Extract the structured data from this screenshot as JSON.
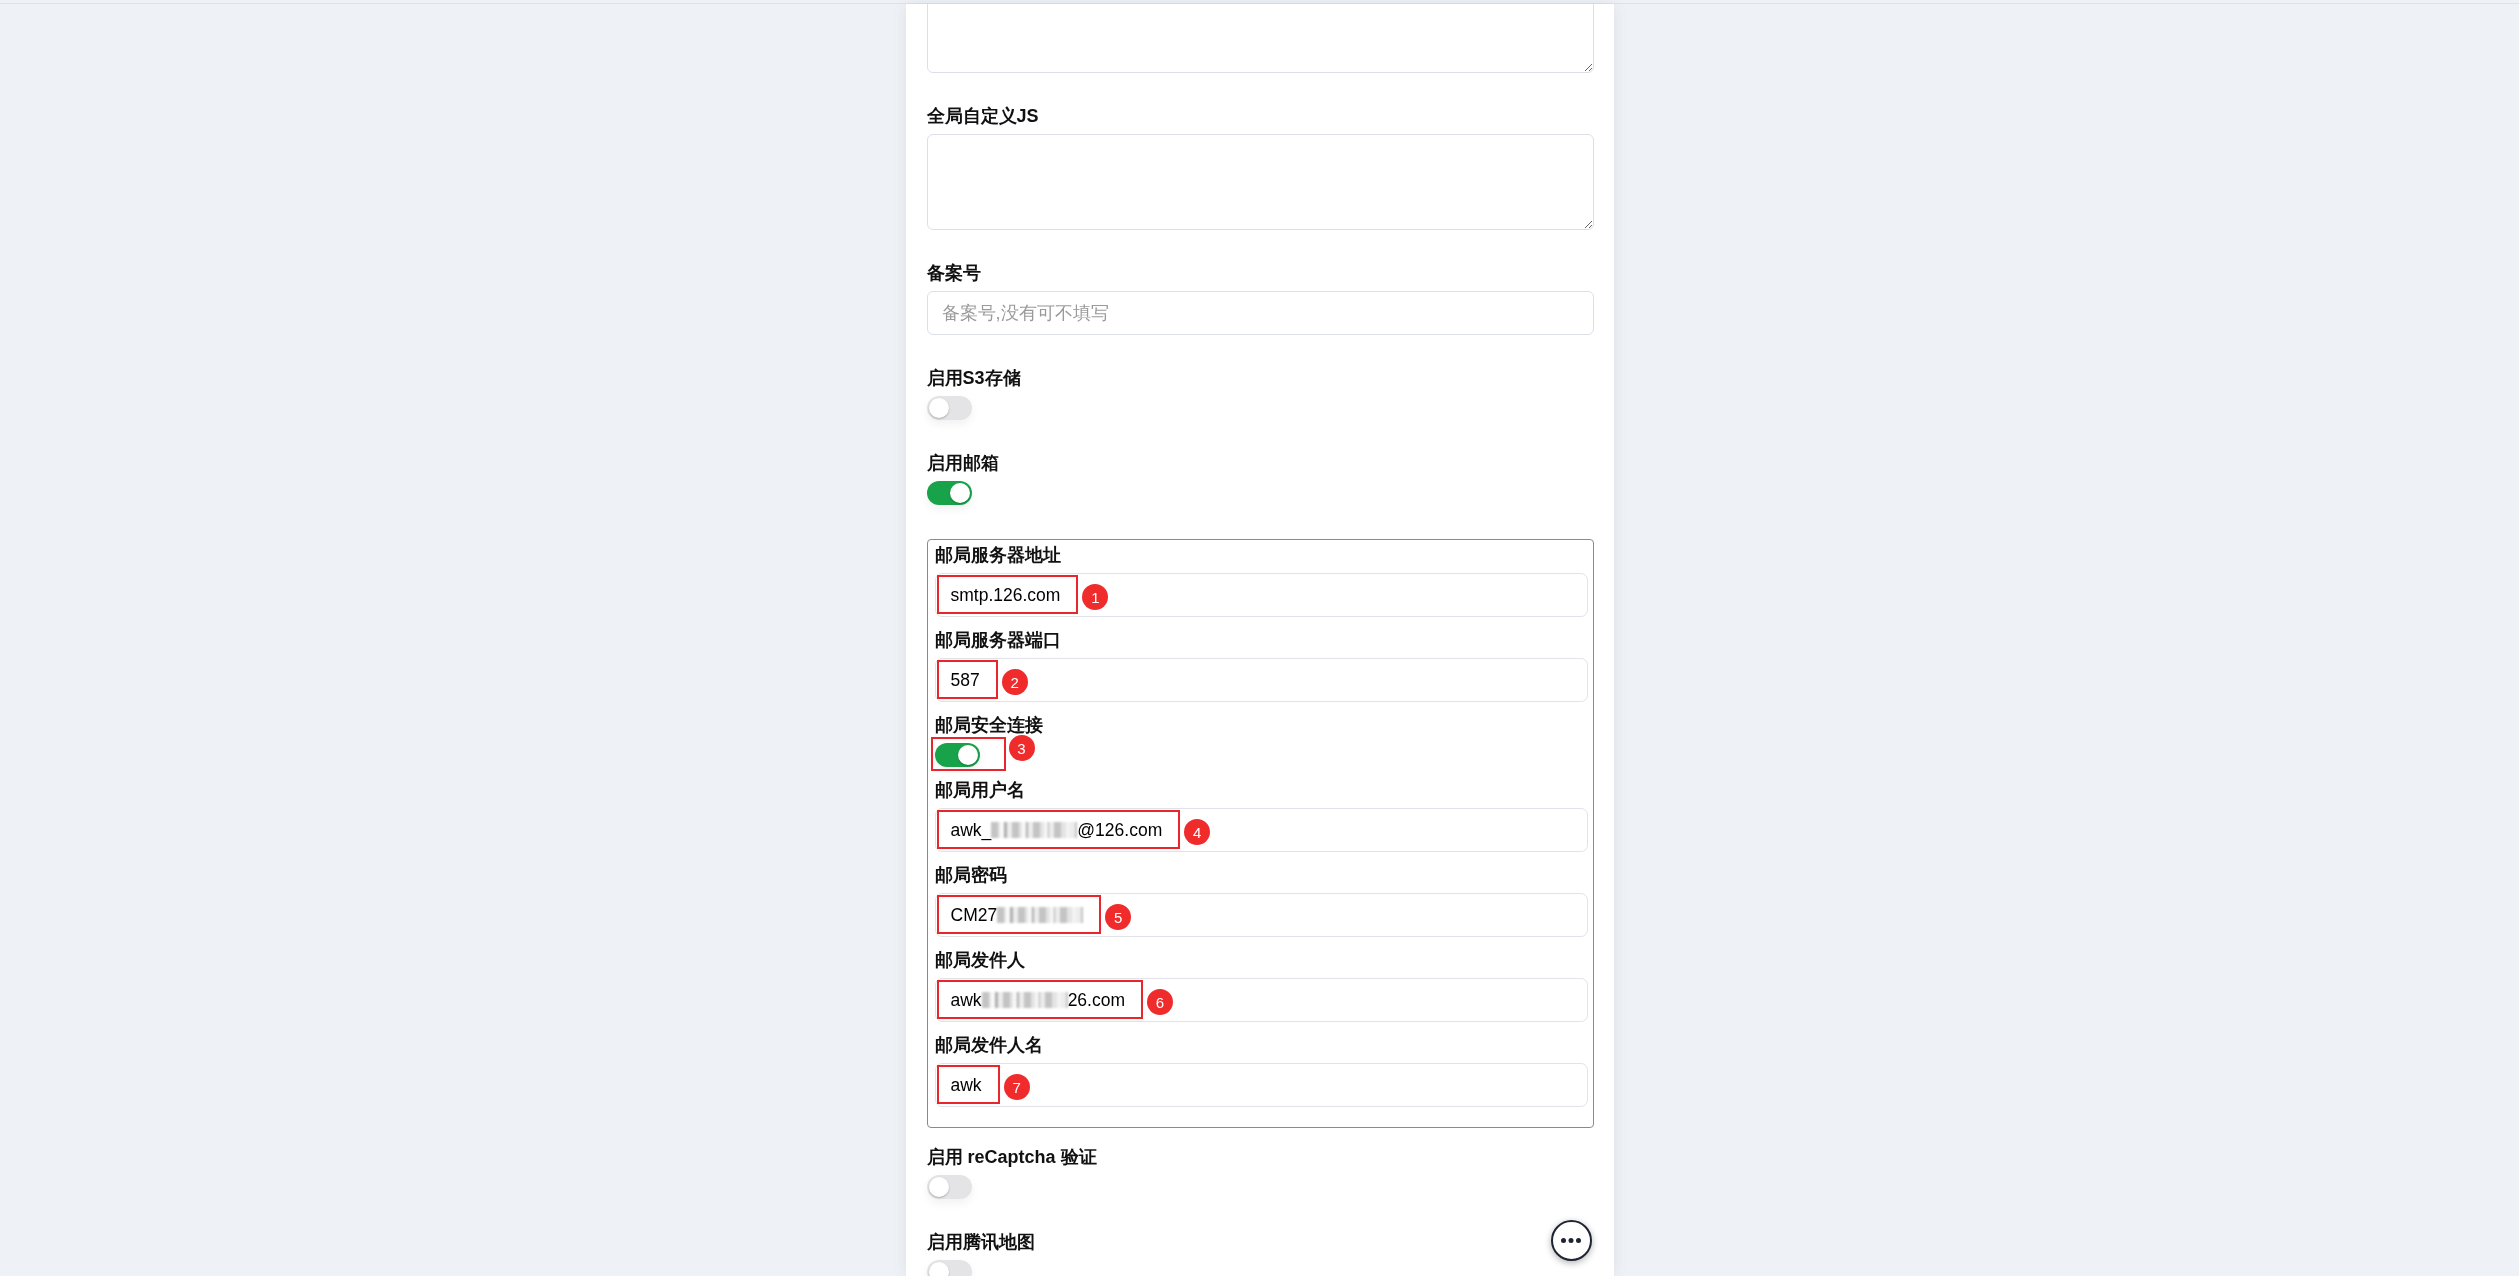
{
  "settings": [
    {
      "kind": "textarea"
    },
    {
      "kind": "textarea",
      "label": "全局自定义JS"
    },
    {
      "kind": "input",
      "label": "备案号",
      "placeholder": "备案号,没有可不填写"
    },
    {
      "kind": "toggle",
      "label": "启用S3存储",
      "on": false
    },
    {
      "kind": "toggle",
      "label": "启用邮箱",
      "on": true
    },
    {
      "kind": "group",
      "items": [
        {
          "kind": "input",
          "label": "邮局服务器地址",
          "value": "smtp.126.com",
          "marker": "1"
        },
        {
          "kind": "input",
          "label": "邮局服务器端口",
          "value": "587",
          "marker": "2"
        },
        {
          "kind": "toggle",
          "label": "邮局安全连接",
          "on": true,
          "marker": "3"
        },
        {
          "kind": "input",
          "label": "邮局用户名",
          "value": "awk_",
          "redacted": true,
          "value_end": "@126.com",
          "marker": "4"
        },
        {
          "kind": "input",
          "label": "邮局密码",
          "value": "CM27",
          "redacted": true,
          "marker": "5"
        },
        {
          "kind": "input",
          "label": "邮局发件人",
          "value": "awk",
          "redacted": true,
          "value_end": "26.com",
          "marker": "6"
        },
        {
          "kind": "input",
          "label": "邮局发件人名",
          "value": "awk",
          "marker": "7"
        }
      ]
    },
    {
      "kind": "toggle",
      "label": "启用 reCaptcha 验证",
      "on": false
    },
    {
      "kind": "toggle",
      "label": "启用腾讯地图",
      "on": false
    }
  ]
}
